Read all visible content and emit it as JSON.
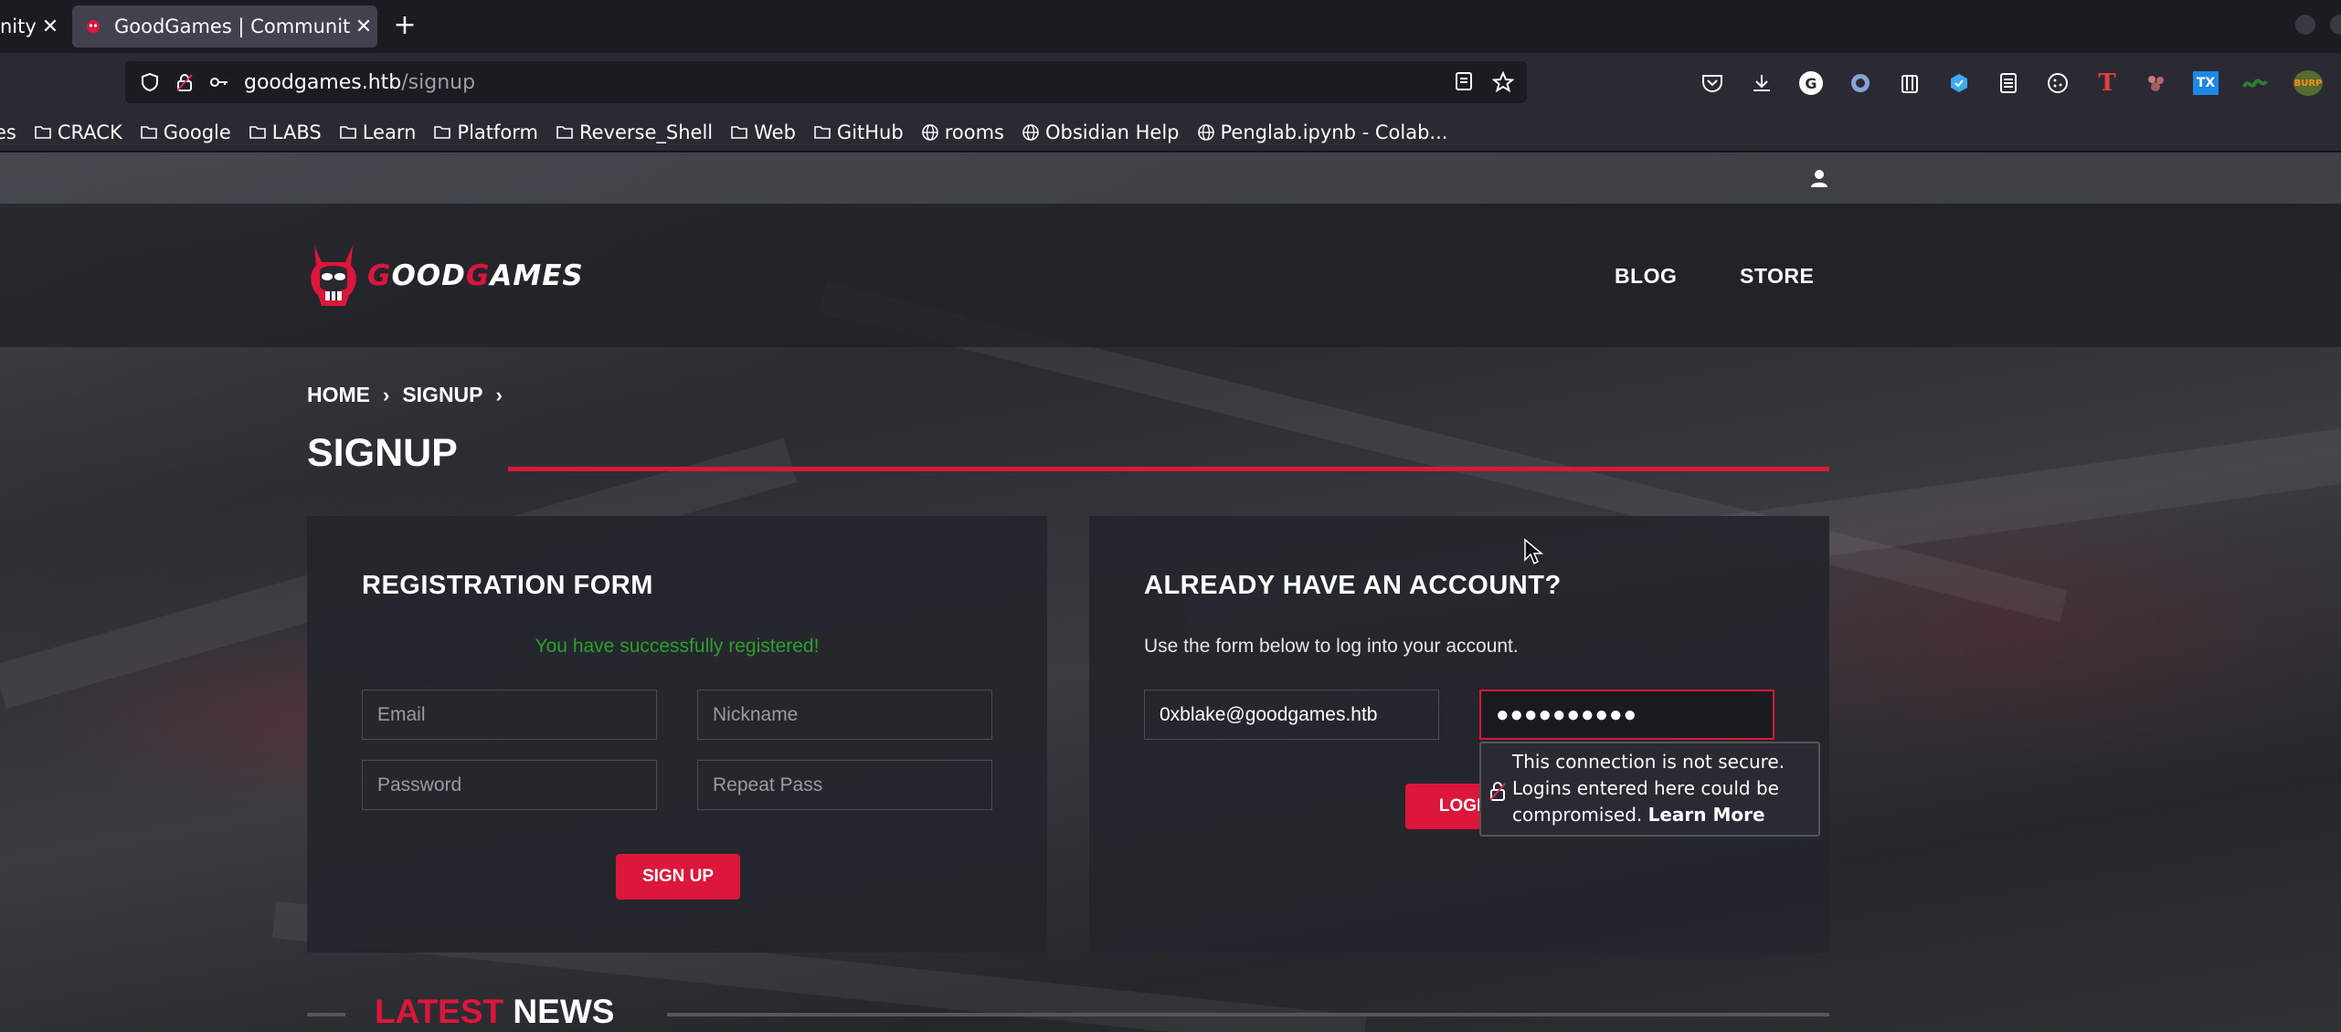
{
  "browser": {
    "tabs": [
      {
        "label": "nity",
        "close": "✕"
      },
      {
        "label": "GoodGames | Community",
        "close": "✕"
      }
    ],
    "new_tab": "+",
    "url": {
      "host": "goodgames.htb",
      "path": "/signup"
    },
    "extensions": [
      "pocket-icon",
      "download-icon",
      "grammarly-icon",
      "foxyproxy-icon",
      "clipboard-icon",
      "wappalyzer-icon",
      "notes-icon",
      "cookie-icon",
      "hacktools-icon",
      "paws-icon",
      "translate-icon",
      "burp-icon"
    ],
    "extension_glyphs": {
      "grammarly": "G",
      "hacktools": "T",
      "translate": "TX",
      "burp": "BURP"
    },
    "bookmarks": [
      "es",
      "CRACK",
      "Google",
      "LABS",
      "Learn",
      "Platform",
      "Reverse_Shell",
      "Web",
      "GitHub",
      "rooms",
      "Obsidian Help",
      "Penglab.ipynb - Colab..."
    ]
  },
  "site": {
    "logo_prefix": "G",
    "logo_mid": "OOD",
    "logo_g2": "G",
    "logo_suffix": "AMES",
    "nav": [
      "BLOG",
      "STORE"
    ],
    "breadcrumb": [
      "HOME",
      "SIGNUP"
    ],
    "page_title": "SIGNUP",
    "registration": {
      "title": "REGISTRATION FORM",
      "success": "You have successfully registered!",
      "email_placeholder": "Email",
      "nickname_placeholder": "Nickname",
      "password_placeholder": "Password",
      "repeat_placeholder": "Repeat Pass",
      "submit": "SIGN UP"
    },
    "login": {
      "title": "ALREADY HAVE AN ACCOUNT?",
      "subtitle": "Use the form below to log into your account.",
      "email_value": "0xblake@goodgames.htb",
      "password_mask": "●●●●●●●●●●",
      "submit": "LOGIN"
    },
    "tooltip": {
      "text": "This connection is not secure. Logins entered here could be compromised.",
      "link": "Learn More"
    },
    "news_accent": "LATEST",
    "news_rest": "NEWS"
  },
  "colors": {
    "accent": "#dd163b",
    "success": "#2ca02c",
    "chrome_bg": "#1c1b22",
    "toolbar_bg": "#2b2a33"
  }
}
